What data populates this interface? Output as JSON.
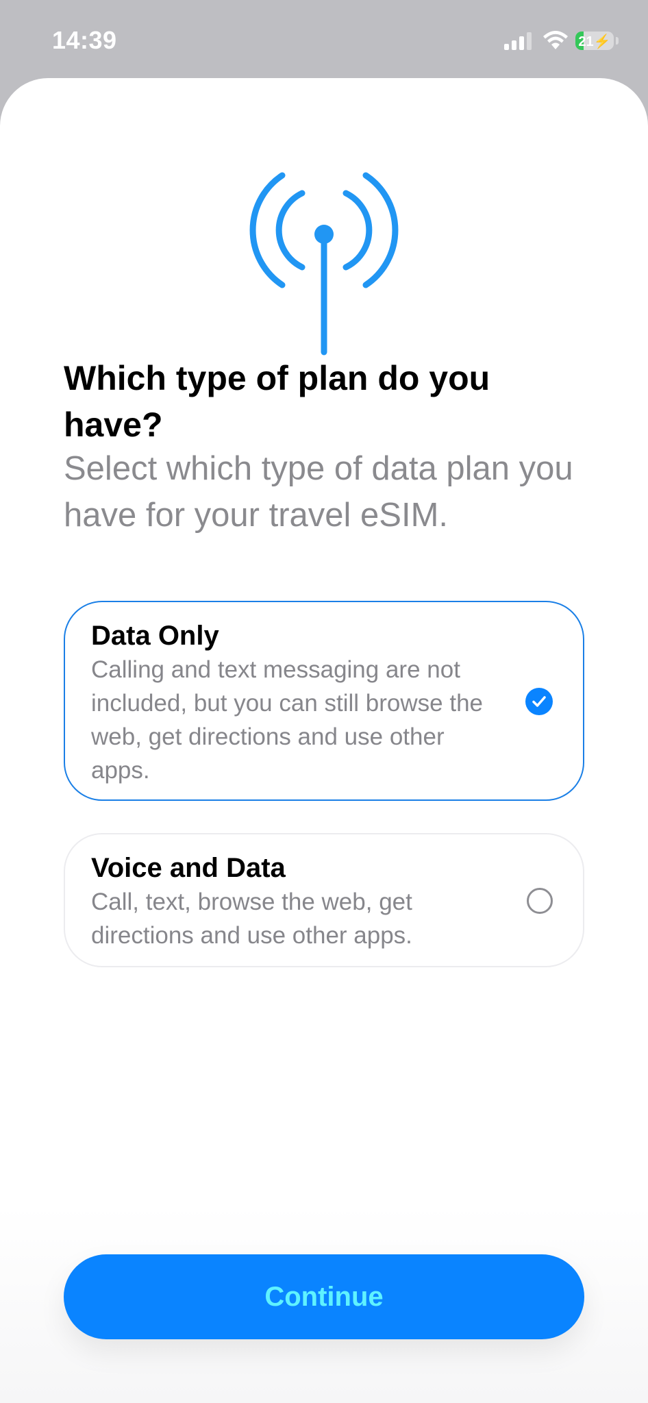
{
  "status_bar": {
    "time": "14:39",
    "battery_level": "21",
    "battery_charging": true,
    "colors": {
      "battery_fill": "#34c759"
    }
  },
  "hero": {
    "icon": "antenna-signal-icon",
    "color": "#2196f3"
  },
  "title": "Which type of plan do you have?",
  "subtitle": "Select which type of data plan you have for your travel eSIM.",
  "options": [
    {
      "title": "Data Only",
      "description": "Calling and text messaging are not included, but you can still browse the web, get directions and use other apps.",
      "selected": true
    },
    {
      "title": "Voice and Data",
      "description": "Call, text, browse the web, get directions and use other apps.",
      "selected": false
    }
  ],
  "continue_label": "Continue",
  "colors": {
    "accent": "#0a84ff",
    "button_text": "#5ff2ff",
    "selected_border": "#1a7fe6"
  }
}
